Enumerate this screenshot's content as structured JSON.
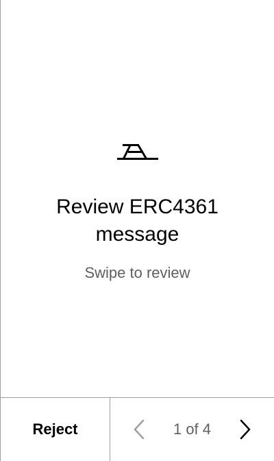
{
  "main": {
    "logo_icon": "trezor-logo-icon",
    "title_line1": "Review ERC4361",
    "title_line2": "message",
    "subtitle": "Swipe to review"
  },
  "footer": {
    "reject_label": "Reject",
    "page_indicator": "1 of 4",
    "prev_icon": "chevron-left-icon",
    "next_icon": "chevron-right-icon",
    "prev_disabled": true
  },
  "colors": {
    "divider": "#9e9e9e",
    "muted_text": "#5f5f5f",
    "disabled_icon": "#9e9e9e",
    "text": "#000000"
  }
}
